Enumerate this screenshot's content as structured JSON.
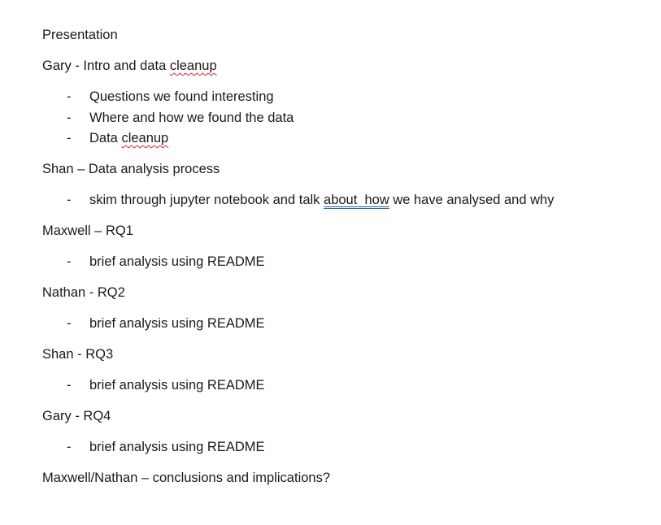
{
  "document": {
    "title": "Presentation",
    "sections": [
      {
        "heading_prefix": "Gary - Intro and data ",
        "heading_flagged": "cleanup",
        "bullets": [
          {
            "text": "Questions we found interesting"
          },
          {
            "text": "Where and how we found the data"
          },
          {
            "prefix": "Data ",
            "flagged": "cleanup"
          }
        ]
      },
      {
        "heading": "Shan – Data analysis process",
        "bullets": [
          {
            "prefix": "skim through jupyter notebook and talk ",
            "flagged": "about  how",
            "suffix": " we have analysed and why"
          }
        ]
      },
      {
        "heading": "Maxwell – RQ1",
        "bullets": [
          {
            "text": "brief analysis using README"
          }
        ]
      },
      {
        "heading": "Nathan - RQ2",
        "bullets": [
          {
            "text": "brief analysis using README"
          }
        ]
      },
      {
        "heading": "Shan - RQ3",
        "bullets": [
          {
            "text": "brief analysis using README"
          }
        ]
      },
      {
        "heading": "Gary - RQ4",
        "bullets": [
          {
            "text": "brief analysis using README"
          }
        ]
      }
    ],
    "closing": "Maxwell/Nathan – conclusions and implications?",
    "bullet_marker": "-"
  }
}
